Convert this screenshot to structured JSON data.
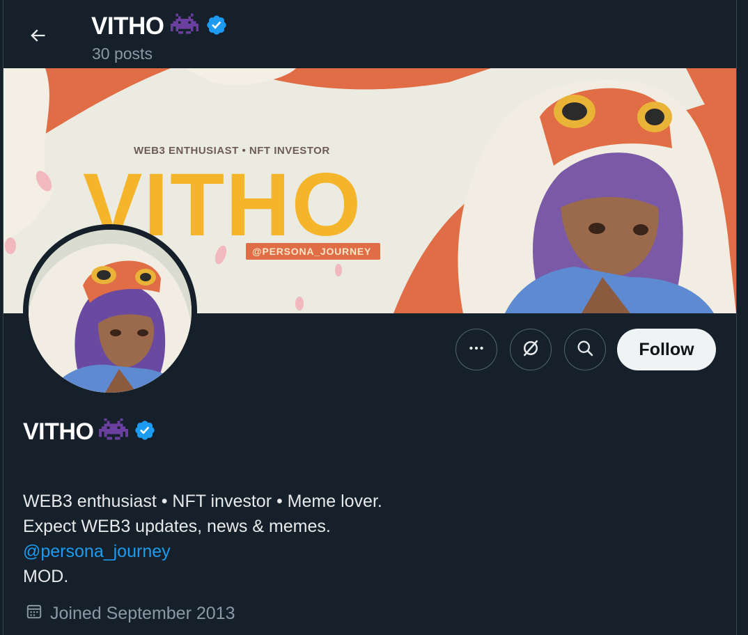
{
  "header": {
    "back_icon": "arrow-left-icon",
    "display_name": "VITHO",
    "emoji_icon": "space-invader-icon",
    "verified_icon": "verified-badge-icon",
    "post_count": "30 posts"
  },
  "banner": {
    "tagline": "WEB3 ENTHUSIAST • NFT INVESTOR",
    "big_title": "VITHO",
    "handle_tag": "@PERSONA_JOURNEY"
  },
  "actions": {
    "more_icon": "more-horizontal-icon",
    "grok_icon": "grok-icon",
    "search_icon": "search-icon",
    "follow_label": "Follow"
  },
  "profile": {
    "display_name": "VITHO",
    "emoji_icon": "space-invader-icon",
    "verified_icon": "verified-badge-icon",
    "bio_line_1": "WEB3 enthusiast • NFT investor • Meme lover.",
    "bio_line_2": "Expect WEB3 updates, news & memes.",
    "bio_mention": "@persona_journey",
    "bio_line_4": "MOD.",
    "joined_icon": "calendar-icon",
    "joined_text": "Joined September 2013"
  },
  "colors": {
    "background": "#15202b",
    "accent_blue": "#1d9bf0",
    "follow_button": "#eff3f4",
    "banner_yellow": "#f5b52a",
    "banner_orange": "#e06d45",
    "emoji_purple": "#6b3fa0"
  }
}
